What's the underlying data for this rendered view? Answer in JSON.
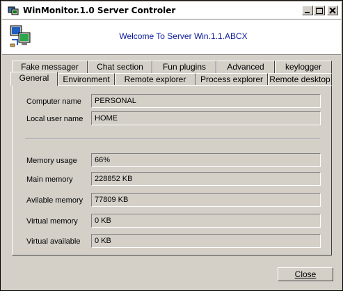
{
  "window": {
    "title": "WinMonitor.1.0 Server Controler"
  },
  "header": {
    "welcome": "Welcome To Server Win.1.1.ABCX"
  },
  "tabs_back": [
    {
      "label": "Fake messager"
    },
    {
      "label": "Chat section"
    },
    {
      "label": "Fun plugins"
    },
    {
      "label": "Advanced"
    },
    {
      "label": "keylogger"
    }
  ],
  "tabs_front": [
    {
      "label": "General",
      "active": true
    },
    {
      "label": "Environment"
    },
    {
      "label": "Remote explorer"
    },
    {
      "label": "Process explorer"
    },
    {
      "label": "Remote desktop"
    }
  ],
  "general": {
    "computer_name": {
      "label": "Computer name",
      "value": "PERSONAL"
    },
    "local_user": {
      "label": "Local user name",
      "value": "HOME"
    },
    "memory_usage": {
      "label": "Memory usage",
      "value": "66%"
    },
    "main_memory": {
      "label": "Main memory",
      "value": "228852 KB"
    },
    "available_memory": {
      "label": "Avilable memory",
      "value": "77809 KB"
    },
    "virtual_memory": {
      "label": "Virtual memory",
      "value": "0 KB"
    },
    "virtual_available": {
      "label": "Virtual available",
      "value": "0 KB"
    }
  },
  "footer": {
    "close_label": "Close"
  },
  "icons": [
    "app-icon",
    "minimize-icon",
    "maximize-icon",
    "close-icon",
    "monitor-network-icon"
  ]
}
